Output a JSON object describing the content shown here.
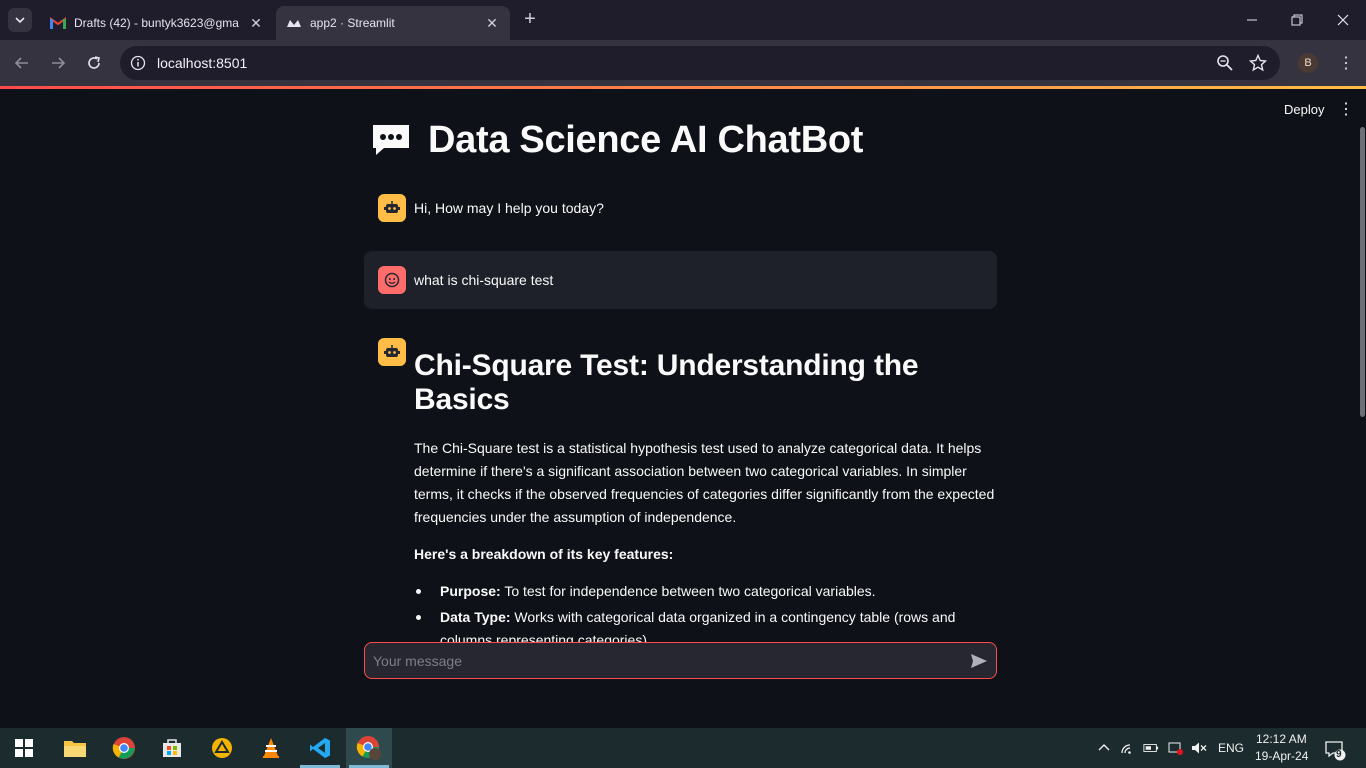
{
  "browser": {
    "tabs": [
      {
        "title": "Drafts (42) - buntyk3623@gma",
        "favicon": "gmail-icon",
        "active": false
      },
      {
        "title": "app2 · Streamlit",
        "favicon": "streamlit-icon",
        "active": true
      }
    ],
    "url": "localhost:8501",
    "profile_initial": "B"
  },
  "streamlit": {
    "deploy_label": "Deploy"
  },
  "app": {
    "title": "Data Science AI ChatBot",
    "title_icon": "speech-bubble-icon",
    "messages": [
      {
        "role": "assistant",
        "avatar": "robot-icon",
        "text": "Hi, How may I help you today?"
      },
      {
        "role": "user",
        "avatar": "smiley-face-icon",
        "text": "what is chi-square test"
      },
      {
        "role": "assistant",
        "avatar": "robot-icon",
        "heading": "Chi-Square Test: Understanding the Basics",
        "paragraph": "The Chi-Square test is a statistical hypothesis test used to analyze categorical data. It helps determine if there's a significant association between two categorical variables. In simpler terms, it checks if the observed frequencies of categories differ significantly from the expected frequencies under the assumption of independence.",
        "breakdown_label": "Here's a breakdown of its key features:",
        "bullets": [
          {
            "term": "Purpose:",
            "text": " To test for independence between two categorical variables."
          },
          {
            "term": "Data Type:",
            "text": " Works with categorical data organized in a contingency table (rows and columns representing categories)."
          }
        ]
      }
    ],
    "input_placeholder": "Your message"
  },
  "taskbar": {
    "apps": [
      "windows-start-icon",
      "file-explorer-icon",
      "chrome-icon",
      "microsoft-store-icon",
      "google-drive-icon",
      "vlc-icon",
      "vscode-icon",
      "chrome-profile-icon"
    ],
    "language": "ENG",
    "time": "12:12 AM",
    "date": "19-Apr-24",
    "notifications": "9"
  },
  "colors": {
    "accent": "#ff4b4b",
    "bot_avatar": "#ffbd45",
    "user_avatar": "#ff6c6c",
    "background": "#0e1117"
  }
}
